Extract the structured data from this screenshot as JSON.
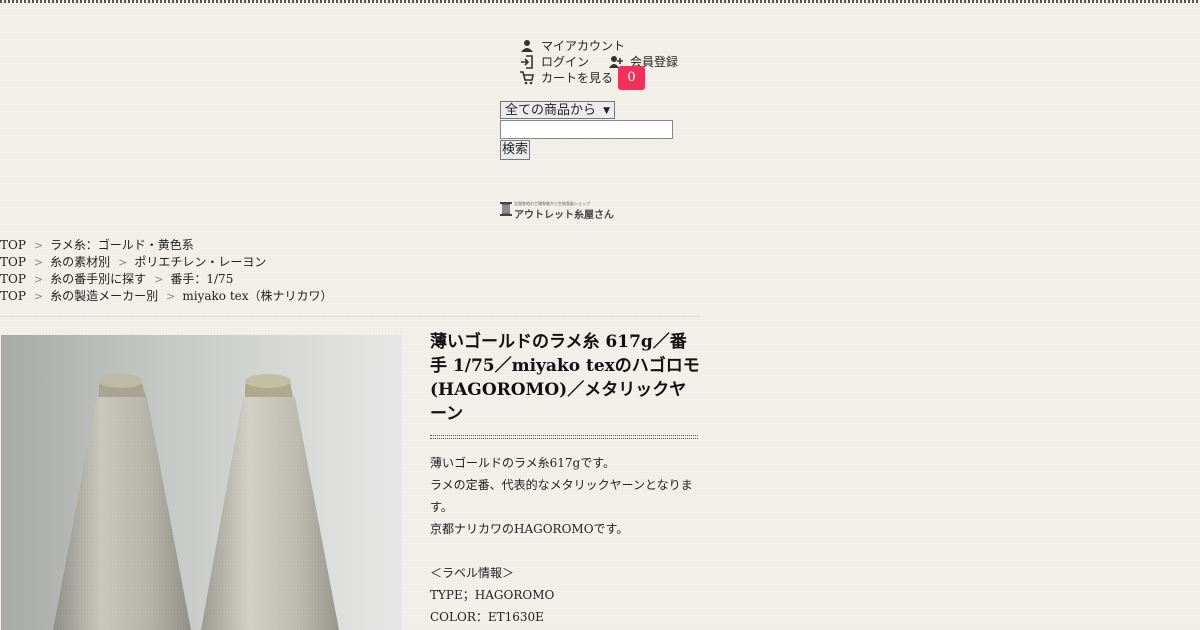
{
  "header": {
    "my_account": "マイアカウント",
    "login": "ログイン",
    "register": "会員登録",
    "view_cart": "カートを見る",
    "cart_count": "0"
  },
  "search": {
    "scope_selected": "全ての商品から",
    "query": "",
    "button_label": "検索"
  },
  "logo": {
    "tagline": "全国各地の工場和装から生地直販ショップ",
    "name": "アウトレット糸屋さん"
  },
  "breadcrumbs": [
    [
      "TOP",
      "ラメ糸：ゴールド・黄色系"
    ],
    [
      "TOP",
      "糸の素材別",
      "ポリエチレン・レーヨン"
    ],
    [
      "TOP",
      "糸の番手別に探す",
      "番手：1/75"
    ],
    [
      "TOP",
      "糸の製造メーカー別",
      "miyako tex（株ナリカワ）"
    ]
  ],
  "breadcrumb_separator": ">",
  "product": {
    "title": "薄いゴールドのラメ糸 617g／番手 1/75／miyako texのハゴロモ(HAGOROMO)／メタリックヤーン",
    "description": [
      "薄いゴールドのラメ糸617gです。",
      "ラメの定番、代表的なメタリックヤーンとなります。",
      "京都ナリカワのHAGOROMOです。",
      "",
      "＜ラベル情報＞",
      "TYPE；HAGOROMO",
      "COLOR：ET1630E"
    ]
  },
  "colors": {
    "background": "#f4f1ec",
    "cart_badge": "#f0325a",
    "text": "#222222"
  }
}
